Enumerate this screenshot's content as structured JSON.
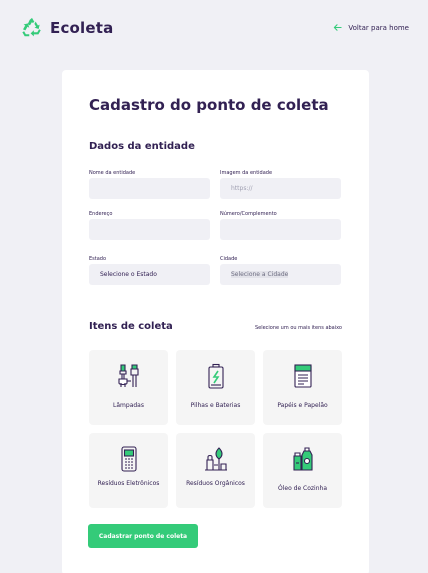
{
  "header": {
    "app_name": "Ecoleta",
    "back_label": "Voltar para home"
  },
  "form": {
    "title": "Cadastro do ponto de coleta",
    "entity_section": "Dados da entidade",
    "fields": {
      "name_label": "Nome da entidade",
      "image_label": "Imagem da entidade",
      "image_placeholder": "https://",
      "address_label": "Endereço",
      "number_label": "Número/Complemento",
      "state_label": "Estado",
      "state_value": "Selecione o Estado",
      "city_label": "Cidade",
      "city_value": "Selecione a Cidade"
    },
    "items_section": "Itens de coleta",
    "items_hint": "Selecione um ou mais itens abaixo",
    "items": [
      {
        "label": "Lâmpadas",
        "icon": "lightbulb-icon"
      },
      {
        "label": "Pilhas e Baterias",
        "icon": "battery-icon"
      },
      {
        "label": "Papéis e Papelão",
        "icon": "paper-icon"
      },
      {
        "label": "Resíduos Eletrônicos",
        "icon": "electronics-icon"
      },
      {
        "label": "Resíduos Orgânicos",
        "icon": "organic-icon"
      },
      {
        "label": "Óleo de Cozinha",
        "icon": "oil-icon"
      }
    ],
    "submit_label": "Cadastrar ponto de coleta"
  },
  "colors": {
    "primary": "#34cb79",
    "title": "#322153",
    "background": "#f0f0f5",
    "input_bg": "#f0f0f5"
  }
}
